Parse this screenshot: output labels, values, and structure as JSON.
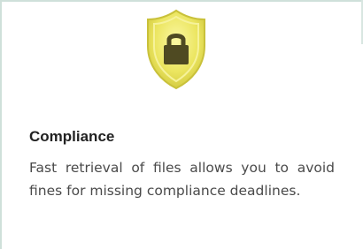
{
  "feature": {
    "icon": "shield-lock-icon",
    "title": "Compliance",
    "description": "Fast retrieval of files allows you to avoid fines for missing compliance deadlines."
  },
  "colors": {
    "shield_outer": "#e9e45a",
    "shield_inner": "#f2ee7c",
    "shield_border": "#c9c13a",
    "lock_body": "#4f4a22",
    "frame": "#cfe0da",
    "title": "#222222",
    "text": "#4a4a4a"
  }
}
